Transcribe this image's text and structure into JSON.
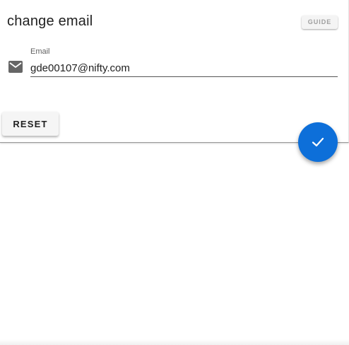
{
  "header": {
    "title": "change email",
    "guide_label": "GUIDE"
  },
  "email_field": {
    "label": "Email",
    "value": "gde00107@nifty.com",
    "icon": "mail-icon"
  },
  "actions": {
    "reset_label": "RESET",
    "confirm_icon": "check-icon"
  },
  "colors": {
    "accent": "#0d6fd9",
    "text": "#212121",
    "muted": "#9e9e9e"
  }
}
